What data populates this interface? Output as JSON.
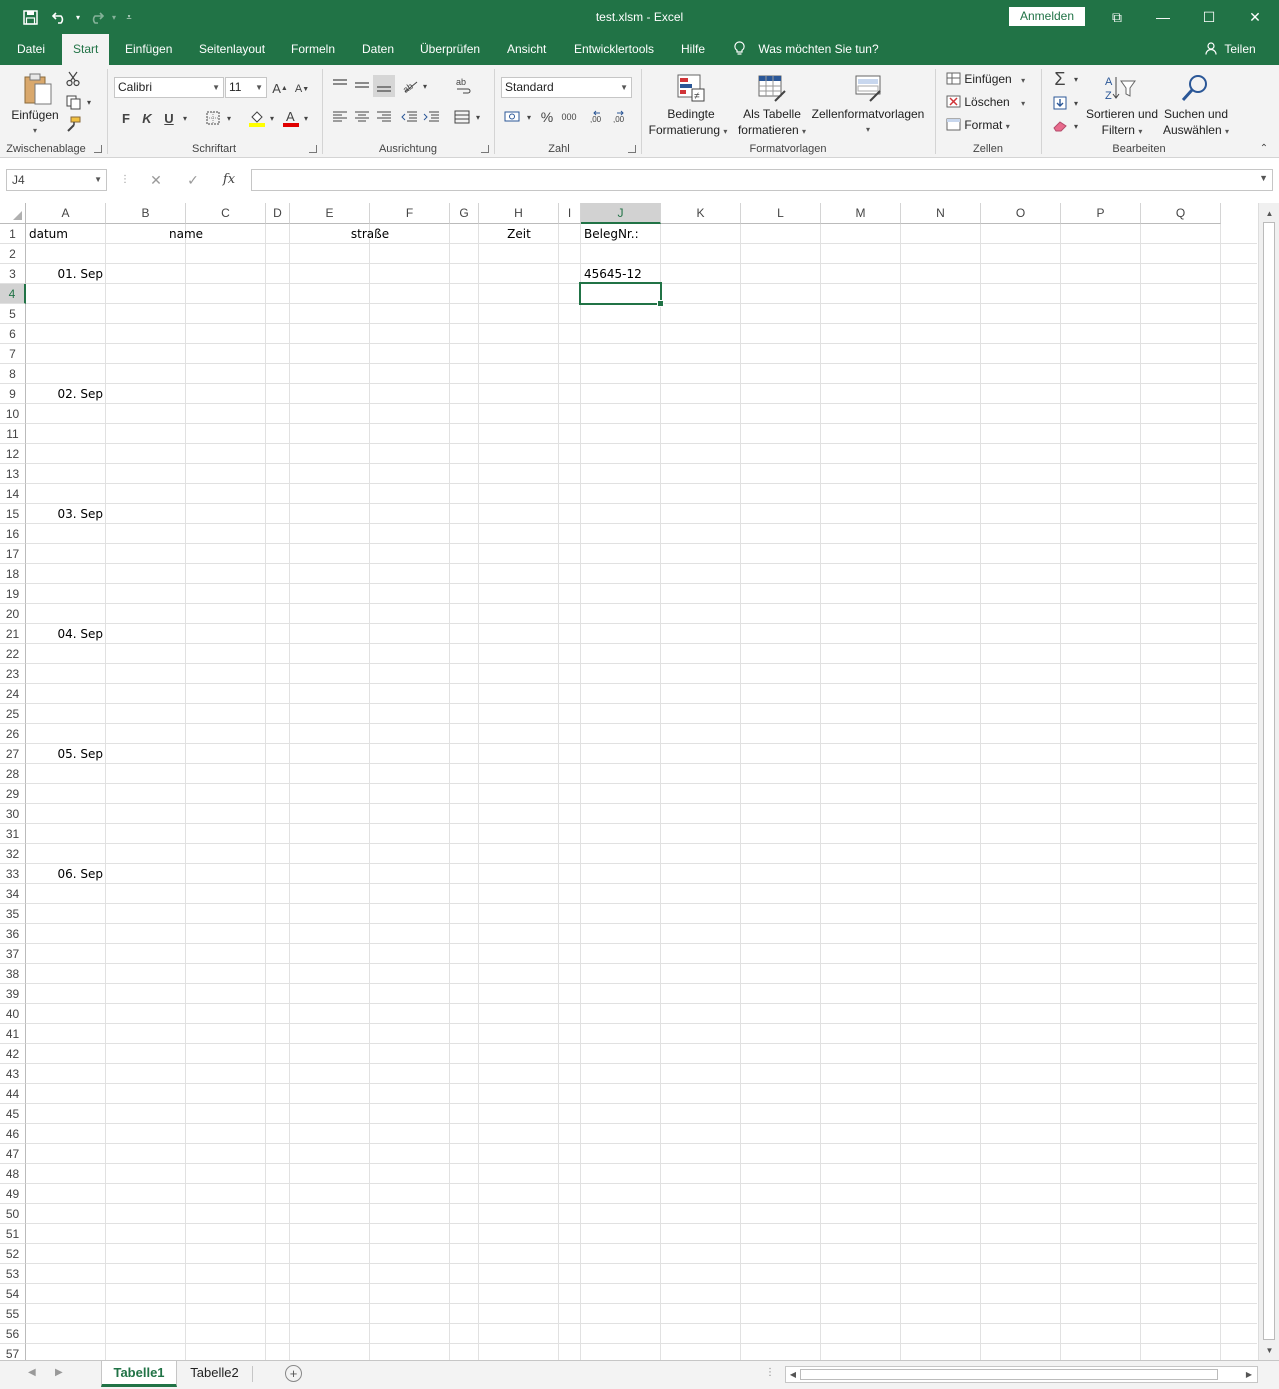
{
  "window": {
    "title": "test.xlsm  -  Excel",
    "signin_label": "Anmelden",
    "minimize_glyph": "—",
    "maximize_glyph": "☐",
    "close_glyph": "✕",
    "ribbon_display_glyph": "⧉"
  },
  "quick_access": {
    "save_icon": "save-icon",
    "undo_icon": "undo-icon",
    "redo_icon": "redo-icon",
    "customize_icon": "customize-icon"
  },
  "ribbon_tabs": [
    "Datei",
    "Start",
    "Einfügen",
    "Seitenlayout",
    "Formeln",
    "Daten",
    "Überprüfen",
    "Ansicht",
    "Entwicklertools",
    "Hilfe"
  ],
  "active_tab": "Start",
  "tell_me": "Was möchten Sie tun?",
  "share": "Teilen",
  "clipboard": {
    "paste_label": "Einfügen",
    "group_label": "Zwischenablage"
  },
  "font": {
    "family": "Calibri",
    "size": "11",
    "bold": "F",
    "italic": "K",
    "underline": "U",
    "grow": "A",
    "shrink": "A",
    "group_label": "Schriftart"
  },
  "alignment": {
    "group_label": "Ausrichtung"
  },
  "number": {
    "format": "Standard",
    "percent": "%",
    "thousands": "000",
    "group_label": "Zahl"
  },
  "styles": {
    "conditional_line1": "Bedingte",
    "conditional_line2": "Formatierung",
    "table_line1": "Als Tabelle",
    "table_line2": "formatieren",
    "cellstyles": "Zellenformatvorlagen",
    "group_label": "Formatvorlagen"
  },
  "cells": {
    "insert": "Einfügen",
    "delete": "Löschen",
    "format": "Format",
    "group_label": "Zellen"
  },
  "editing": {
    "sort_line1": "Sortieren und",
    "sort_line2": "Filtern",
    "find_line1": "Suchen und",
    "find_line2": "Auswählen",
    "group_label": "Bearbeiten"
  },
  "formula_bar": {
    "name_box": "J4",
    "cancel": "✕",
    "enter": "✓",
    "fx": "fx",
    "value": ""
  },
  "sheet": {
    "columns": [
      "A",
      "B",
      "C",
      "D",
      "E",
      "F",
      "G",
      "H",
      "I",
      "J",
      "K",
      "L",
      "M",
      "N",
      "O",
      "P",
      "Q"
    ],
    "selected_column": "J",
    "selected_row": 4,
    "row_count": 57,
    "cells": [
      {
        "ref": "A1",
        "text": "datum",
        "align": "left"
      },
      {
        "ref": "B1",
        "text": "name",
        "align": "center-BC"
      },
      {
        "ref": "E1",
        "text": "straße",
        "align": "center-EF"
      },
      {
        "ref": "H1",
        "text": "Zeit",
        "align": "center"
      },
      {
        "ref": "J1",
        "text": "BelegNr.:",
        "align": "left"
      },
      {
        "ref": "A3",
        "text": "01. Sep",
        "align": "right"
      },
      {
        "ref": "J3",
        "text": "45645-12",
        "align": "left"
      },
      {
        "ref": "A9",
        "text": "02. Sep",
        "align": "right"
      },
      {
        "ref": "A15",
        "text": "03. Sep",
        "align": "right"
      },
      {
        "ref": "A21",
        "text": "04. Sep",
        "align": "right"
      },
      {
        "ref": "A27",
        "text": "05. Sep",
        "align": "right"
      },
      {
        "ref": "A33",
        "text": "06. Sep",
        "align": "right"
      }
    ]
  },
  "sheet_tabs": [
    "Tabelle1",
    "Tabelle2"
  ],
  "active_sheet": "Tabelle1"
}
